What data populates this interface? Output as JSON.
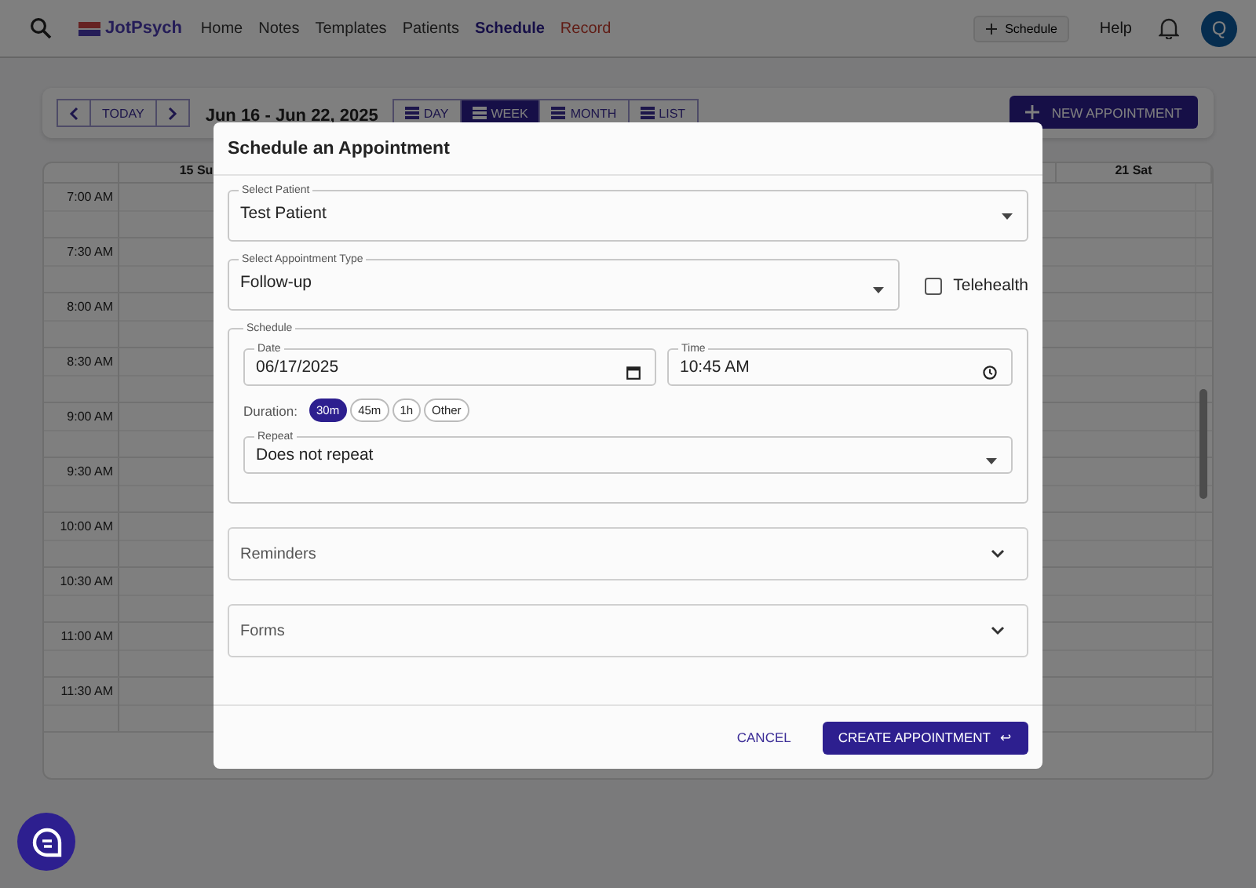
{
  "nav": {
    "logo": "JotPsych",
    "items": [
      {
        "label": "Home",
        "selected": false,
        "kind": "link"
      },
      {
        "label": "Notes",
        "selected": false,
        "kind": "link"
      },
      {
        "label": "Templates",
        "selected": false,
        "kind": "link"
      },
      {
        "label": "Patients",
        "selected": false,
        "kind": "link"
      },
      {
        "label": "Schedule",
        "selected": true,
        "kind": "link"
      },
      {
        "label": "Record",
        "selected": false,
        "kind": "record"
      }
    ],
    "schedule_button": "Schedule",
    "help": "Help",
    "avatar": "Q"
  },
  "toolbar": {
    "today": "TODAY",
    "range": "Jun 16 - Jun 22, 2025",
    "views": [
      {
        "label": "DAY",
        "selected": false
      },
      {
        "label": "WEEK",
        "selected": true
      },
      {
        "label": "MONTH",
        "selected": false
      },
      {
        "label": "LIST",
        "selected": false
      }
    ],
    "new_appointment": "NEW APPOINTMENT"
  },
  "calendar": {
    "days": [
      "15 Su",
      "21 Sat"
    ],
    "times": [
      "7:00 AM",
      "7:30 AM",
      "8:00 AM",
      "8:30 AM",
      "9:00 AM",
      "9:30 AM",
      "10:00 AM",
      "10:30 AM",
      "11:00 AM",
      "11:30 AM"
    ]
  },
  "dialog": {
    "title": "Schedule an Appointment",
    "patient": {
      "label": "Select Patient",
      "value": "Test Patient"
    },
    "appointment_type": {
      "label": "Select Appointment Type",
      "value": "Follow-up"
    },
    "telehealth": {
      "label": "Telehealth",
      "checked": false
    },
    "schedule": {
      "legend": "Schedule",
      "date": {
        "label": "Date",
        "value": "06/17/2025"
      },
      "time": {
        "label": "Time",
        "value": "10:45 AM"
      },
      "duration_label": "Duration:",
      "durations": [
        {
          "label": "30m",
          "selected": true
        },
        {
          "label": "45m",
          "selected": false
        },
        {
          "label": "1h",
          "selected": false
        },
        {
          "label": "Other",
          "selected": false
        }
      ],
      "repeat": {
        "label": "Repeat",
        "value": "Does not repeat"
      }
    },
    "sections": [
      {
        "title": "Reminders",
        "expanded": false
      },
      {
        "title": "Forms",
        "expanded": false
      }
    ],
    "cancel": "CANCEL",
    "create": "CREATE APPOINTMENT",
    "create_icon": "↩"
  }
}
